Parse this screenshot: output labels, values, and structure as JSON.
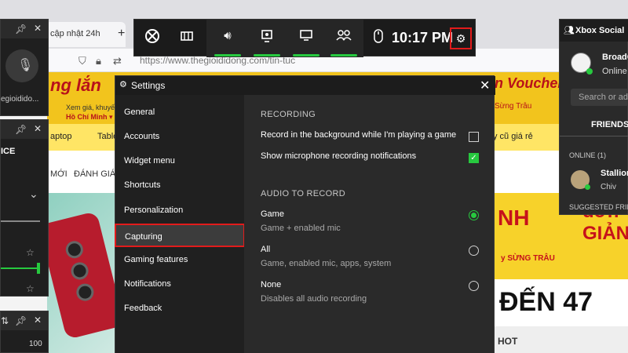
{
  "browser": {
    "tab_title": "cập nhật 24h",
    "tab_close": "✕",
    "new_tab": "+",
    "url": "https://www.thegioididong.com/tin-tuc",
    "banner_title": "ng lắn",
    "banner_sub1": "Xem giá, khuyến",
    "banner_sub2": "Hồ Chí Minh ▾",
    "banner_right": "n Voucher",
    "banner_right_sub": "Sừng Trâu",
    "nav_a": "aptop",
    "nav_b": "Table",
    "nav_right": "y cũ giá rẻ",
    "cat_1": "MỚI",
    "cat_2": "ĐÁNH GIÁ",
    "promo_big": "NH",
    "promo_small": "y SỪNG TRÂU",
    "promo_right_text": "đơn GIẢN",
    "promo_den": "ĐẾN 47",
    "hot": "HOT"
  },
  "widgets": {
    "audio_text": "egioidido...",
    "capture_title": "ICE",
    "perf_value": "100"
  },
  "gamebar": {
    "time": "10:17 PM",
    "icons": [
      "xbox-icon",
      "widget-store-icon",
      "audio-icon",
      "capture-icon",
      "performance-icon",
      "social-icon",
      "mouse-icon",
      "settings-icon"
    ]
  },
  "settings": {
    "title": "Settings",
    "nav": [
      {
        "label": "General"
      },
      {
        "label": "Accounts"
      },
      {
        "label": "Widget menu"
      },
      {
        "label": "Shortcuts"
      },
      {
        "label": "Personalization"
      },
      {
        "label": "Capturing"
      },
      {
        "label": "Gaming features"
      },
      {
        "label": "Notifications"
      },
      {
        "label": "Feedback"
      }
    ],
    "active_index": 5,
    "recording": {
      "heading": "RECORDING",
      "options": [
        {
          "label": "Record in the background while I'm playing a game",
          "checked": false
        },
        {
          "label": "Show microphone recording notifications",
          "checked": true
        }
      ]
    },
    "audio": {
      "heading": "AUDIO TO RECORD",
      "options": [
        {
          "label": "Game",
          "sub": "Game + enabled mic",
          "selected": true
        },
        {
          "label": "All",
          "sub": "Game, enabled mic, apps, system",
          "selected": false
        },
        {
          "label": "None",
          "sub": "Disables all audio recording",
          "selected": false
        }
      ]
    }
  },
  "social": {
    "title": "Xbox Social",
    "user": "BroadC",
    "status": "Online",
    "search_placeholder": "Search or ad",
    "friends_tab": "FRIENDS",
    "online_label": "ONLINE  (1)",
    "friend_name": "Stallion",
    "friend_status": "Chiv",
    "suggested_label": "SUGGESTED FRIENDS"
  },
  "colors": {
    "accent_green": "#27c93f",
    "highlight_red": "#e21b1b"
  }
}
